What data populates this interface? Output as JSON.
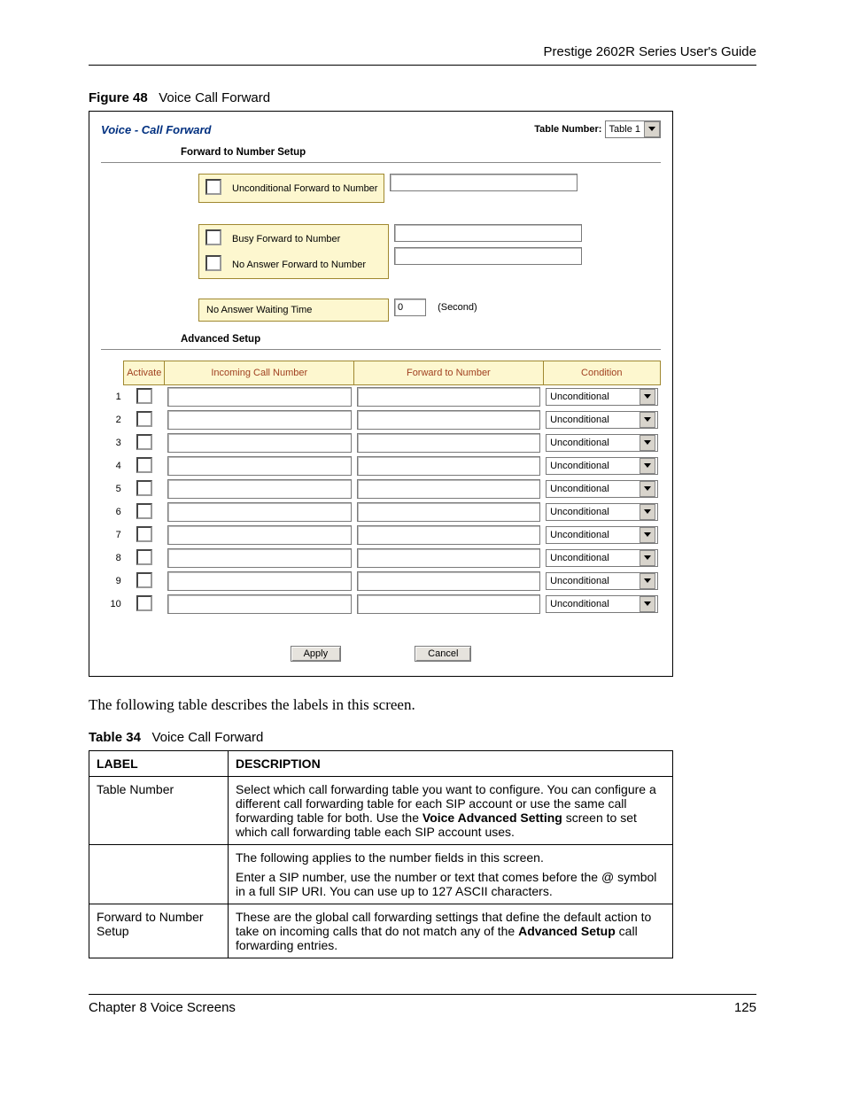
{
  "header": {
    "guide": "Prestige 2602R Series User's Guide"
  },
  "figure": {
    "prefix": "Figure 48",
    "title": "Voice Call Forward"
  },
  "shot": {
    "title": "Voice - Call Forward",
    "table_number_label": "Table Number:",
    "table_number_value": "Table 1",
    "forward_section": "Forward to Number Setup",
    "unconditional": "Unconditional Forward to Number",
    "busy": "Busy Forward to Number",
    "noanswer": "No Answer Forward to Number",
    "waiting": "No Answer Waiting Time",
    "waiting_value": "0",
    "waiting_unit": "(Second)",
    "advanced_section": "Advanced Setup",
    "col_activate": "Activate",
    "col_incoming": "Incoming Call Number",
    "col_forward": "Forward to Number",
    "col_condition": "Condition",
    "rows": [
      {
        "n": "1",
        "cond": "Unconditional"
      },
      {
        "n": "2",
        "cond": "Unconditional"
      },
      {
        "n": "3",
        "cond": "Unconditional"
      },
      {
        "n": "4",
        "cond": "Unconditional"
      },
      {
        "n": "5",
        "cond": "Unconditional"
      },
      {
        "n": "6",
        "cond": "Unconditional"
      },
      {
        "n": "7",
        "cond": "Unconditional"
      },
      {
        "n": "8",
        "cond": "Unconditional"
      },
      {
        "n": "9",
        "cond": "Unconditional"
      },
      {
        "n": "10",
        "cond": "Unconditional"
      }
    ],
    "apply": "Apply",
    "cancel": "Cancel"
  },
  "body_text": "The following table describes the labels in this screen.",
  "table_caption": {
    "prefix": "Table 34",
    "title": "Voice Call Forward"
  },
  "desc_table": {
    "h_label": "LABEL",
    "h_desc": "DESCRIPTION",
    "r1_label": "Table Number",
    "r1_desc_a": "Select which call forwarding table you want to configure. You can configure a different call forwarding table for each SIP account or use the same call forwarding table for both. Use the ",
    "r1_desc_b": "Voice Advanced Setting",
    "r1_desc_c": " screen to set which call forwarding table each SIP account uses.",
    "r2_desc_a": "The following applies to the number fields in this screen.",
    "r2_desc_b": "Enter a SIP number, use the number or text that comes before the @ symbol in a full SIP URI. You can use up to 127 ASCII characters.",
    "r3_label": "Forward to Number Setup",
    "r3_desc_a": "These are the global call forwarding settings that define the default action to take on incoming calls that do not match any of the ",
    "r3_desc_b": "Advanced Setup",
    "r3_desc_c": " call forwarding entries."
  },
  "footer": {
    "chapter": "Chapter 8 Voice Screens",
    "page": "125"
  }
}
